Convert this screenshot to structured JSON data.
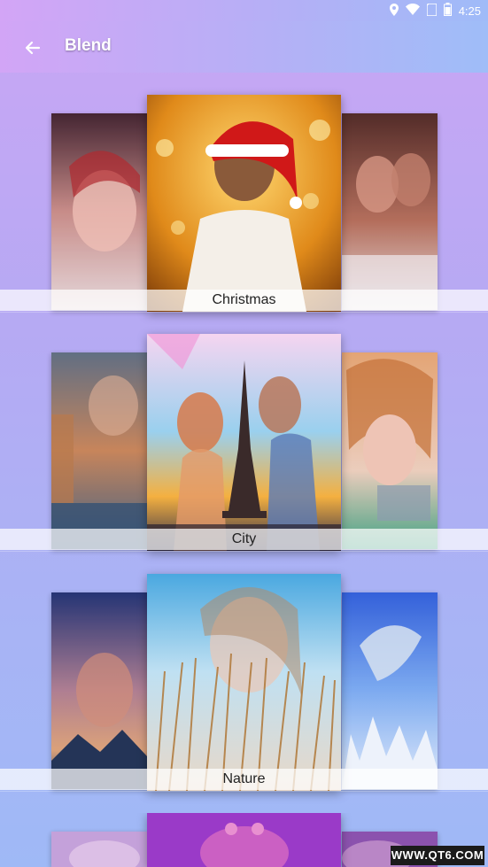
{
  "status_bar": {
    "time": "4:25"
  },
  "app_bar": {
    "title": "Blend"
  },
  "categories": [
    {
      "label": "Christmas"
    },
    {
      "label": "City"
    },
    {
      "label": "Nature"
    }
  ],
  "watermark": "WWW.QT6.COM",
  "colors": {
    "accent_start": "#d2a5f6",
    "accent_end": "#9fbdf8"
  }
}
